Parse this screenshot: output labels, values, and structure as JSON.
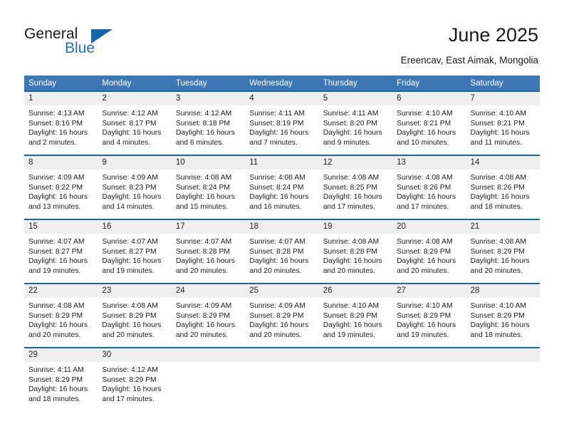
{
  "brand": {
    "name_part1": "General",
    "name_part2": "Blue",
    "triangle_color": "#1566ab",
    "blue_color": "#1f72bd"
  },
  "header": {
    "title": "June 2025",
    "subtitle": "Ereencav, East Aimak, Mongolia"
  },
  "theme": {
    "header_bg": "#3d77b5",
    "row_divider": "#1566ab",
    "daynum_bg": "#efefef"
  },
  "weekdays": [
    "Sunday",
    "Monday",
    "Tuesday",
    "Wednesday",
    "Thursday",
    "Friday",
    "Saturday"
  ],
  "labels": {
    "sunrise_prefix": "Sunrise:",
    "sunset_prefix": "Sunset:",
    "daylight_prefix": "Daylight:"
  },
  "weeks": [
    [
      {
        "day": "1",
        "sunrise": "Sunrise: 4:13 AM",
        "sunset": "Sunset: 8:16 PM",
        "daylight": "Daylight: 16 hours and 2 minutes."
      },
      {
        "day": "2",
        "sunrise": "Sunrise: 4:12 AM",
        "sunset": "Sunset: 8:17 PM",
        "daylight": "Daylight: 16 hours and 4 minutes."
      },
      {
        "day": "3",
        "sunrise": "Sunrise: 4:12 AM",
        "sunset": "Sunset: 8:18 PM",
        "daylight": "Daylight: 16 hours and 6 minutes."
      },
      {
        "day": "4",
        "sunrise": "Sunrise: 4:11 AM",
        "sunset": "Sunset: 8:19 PM",
        "daylight": "Daylight: 16 hours and 7 minutes."
      },
      {
        "day": "5",
        "sunrise": "Sunrise: 4:11 AM",
        "sunset": "Sunset: 8:20 PM",
        "daylight": "Daylight: 16 hours and 9 minutes."
      },
      {
        "day": "6",
        "sunrise": "Sunrise: 4:10 AM",
        "sunset": "Sunset: 8:21 PM",
        "daylight": "Daylight: 16 hours and 10 minutes."
      },
      {
        "day": "7",
        "sunrise": "Sunrise: 4:10 AM",
        "sunset": "Sunset: 8:21 PM",
        "daylight": "Daylight: 16 hours and 11 minutes."
      }
    ],
    [
      {
        "day": "8",
        "sunrise": "Sunrise: 4:09 AM",
        "sunset": "Sunset: 8:22 PM",
        "daylight": "Daylight: 16 hours and 13 minutes."
      },
      {
        "day": "9",
        "sunrise": "Sunrise: 4:09 AM",
        "sunset": "Sunset: 8:23 PM",
        "daylight": "Daylight: 16 hours and 14 minutes."
      },
      {
        "day": "10",
        "sunrise": "Sunrise: 4:08 AM",
        "sunset": "Sunset: 8:24 PM",
        "daylight": "Daylight: 16 hours and 15 minutes."
      },
      {
        "day": "11",
        "sunrise": "Sunrise: 4:08 AM",
        "sunset": "Sunset: 8:24 PM",
        "daylight": "Daylight: 16 hours and 16 minutes."
      },
      {
        "day": "12",
        "sunrise": "Sunrise: 4:08 AM",
        "sunset": "Sunset: 8:25 PM",
        "daylight": "Daylight: 16 hours and 17 minutes."
      },
      {
        "day": "13",
        "sunrise": "Sunrise: 4:08 AM",
        "sunset": "Sunset: 8:26 PM",
        "daylight": "Daylight: 16 hours and 17 minutes."
      },
      {
        "day": "14",
        "sunrise": "Sunrise: 4:08 AM",
        "sunset": "Sunset: 8:26 PM",
        "daylight": "Daylight: 16 hours and 18 minutes."
      }
    ],
    [
      {
        "day": "15",
        "sunrise": "Sunrise: 4:07 AM",
        "sunset": "Sunset: 8:27 PM",
        "daylight": "Daylight: 16 hours and 19 minutes."
      },
      {
        "day": "16",
        "sunrise": "Sunrise: 4:07 AM",
        "sunset": "Sunset: 8:27 PM",
        "daylight": "Daylight: 16 hours and 19 minutes."
      },
      {
        "day": "17",
        "sunrise": "Sunrise: 4:07 AM",
        "sunset": "Sunset: 8:28 PM",
        "daylight": "Daylight: 16 hours and 20 minutes."
      },
      {
        "day": "18",
        "sunrise": "Sunrise: 4:07 AM",
        "sunset": "Sunset: 8:28 PM",
        "daylight": "Daylight: 16 hours and 20 minutes."
      },
      {
        "day": "19",
        "sunrise": "Sunrise: 4:08 AM",
        "sunset": "Sunset: 8:28 PM",
        "daylight": "Daylight: 16 hours and 20 minutes."
      },
      {
        "day": "20",
        "sunrise": "Sunrise: 4:08 AM",
        "sunset": "Sunset: 8:29 PM",
        "daylight": "Daylight: 16 hours and 20 minutes."
      },
      {
        "day": "21",
        "sunrise": "Sunrise: 4:08 AM",
        "sunset": "Sunset: 8:29 PM",
        "daylight": "Daylight: 16 hours and 20 minutes."
      }
    ],
    [
      {
        "day": "22",
        "sunrise": "Sunrise: 4:08 AM",
        "sunset": "Sunset: 8:29 PM",
        "daylight": "Daylight: 16 hours and 20 minutes."
      },
      {
        "day": "23",
        "sunrise": "Sunrise: 4:08 AM",
        "sunset": "Sunset: 8:29 PM",
        "daylight": "Daylight: 16 hours and 20 minutes."
      },
      {
        "day": "24",
        "sunrise": "Sunrise: 4:09 AM",
        "sunset": "Sunset: 8:29 PM",
        "daylight": "Daylight: 16 hours and 20 minutes."
      },
      {
        "day": "25",
        "sunrise": "Sunrise: 4:09 AM",
        "sunset": "Sunset: 8:29 PM",
        "daylight": "Daylight: 16 hours and 20 minutes."
      },
      {
        "day": "26",
        "sunrise": "Sunrise: 4:10 AM",
        "sunset": "Sunset: 8:29 PM",
        "daylight": "Daylight: 16 hours and 19 minutes."
      },
      {
        "day": "27",
        "sunrise": "Sunrise: 4:10 AM",
        "sunset": "Sunset: 8:29 PM",
        "daylight": "Daylight: 16 hours and 19 minutes."
      },
      {
        "day": "28",
        "sunrise": "Sunrise: 4:10 AM",
        "sunset": "Sunset: 8:29 PM",
        "daylight": "Daylight: 16 hours and 18 minutes."
      }
    ],
    [
      {
        "day": "29",
        "sunrise": "Sunrise: 4:11 AM",
        "sunset": "Sunset: 8:29 PM",
        "daylight": "Daylight: 16 hours and 18 minutes."
      },
      {
        "day": "30",
        "sunrise": "Sunrise: 4:12 AM",
        "sunset": "Sunset: 8:29 PM",
        "daylight": "Daylight: 16 hours and 17 minutes."
      },
      {
        "day": "",
        "sunrise": "",
        "sunset": "",
        "daylight": ""
      },
      {
        "day": "",
        "sunrise": "",
        "sunset": "",
        "daylight": ""
      },
      {
        "day": "",
        "sunrise": "",
        "sunset": "",
        "daylight": ""
      },
      {
        "day": "",
        "sunrise": "",
        "sunset": "",
        "daylight": ""
      },
      {
        "day": "",
        "sunrise": "",
        "sunset": "",
        "daylight": ""
      }
    ]
  ]
}
